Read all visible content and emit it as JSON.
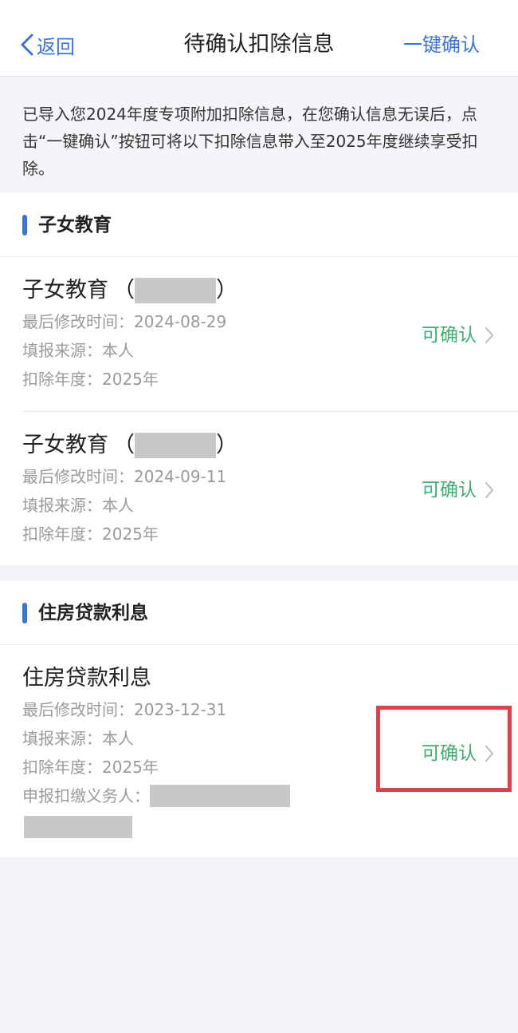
{
  "nav": {
    "back_label": "返回",
    "title": "待确认扣除信息",
    "action_label": "一键确认"
  },
  "notice": {
    "text": "已导入您2024年度专项附加扣除信息，在您确认信息无误后，点击“一键确认”按钮可将以下扣除信息带入至2025年度继续享受扣除。"
  },
  "sections": [
    {
      "title": "子女教育",
      "items": [
        {
          "title": "子女教育",
          "open_paren": "（",
          "close_paren": "）",
          "modified": "最后修改时间：2024-08-29",
          "source": "填报来源：本人",
          "year": "扣除年度：2025年",
          "status": "可确认"
        },
        {
          "title": "子女教育",
          "open_paren": "（",
          "close_paren": "）",
          "modified": "最后修改时间：2024-09-11",
          "source": "填报来源：本人",
          "year": "扣除年度：2025年",
          "status": "可确认"
        }
      ]
    },
    {
      "title": "住房贷款利息",
      "items": [
        {
          "title": "住房贷款利息",
          "modified": "最后修改时间：2023-12-31",
          "source": "填报来源：本人",
          "year": "扣除年度：2025年",
          "withholder": "申报扣缴义务人：",
          "status": "可确认"
        }
      ]
    }
  ],
  "colors": {
    "accent_blue": "#3a74d9",
    "confirm_green": "#3cae70",
    "highlight_red": "#e04047",
    "redaction_gray": "#c8c8c8"
  }
}
